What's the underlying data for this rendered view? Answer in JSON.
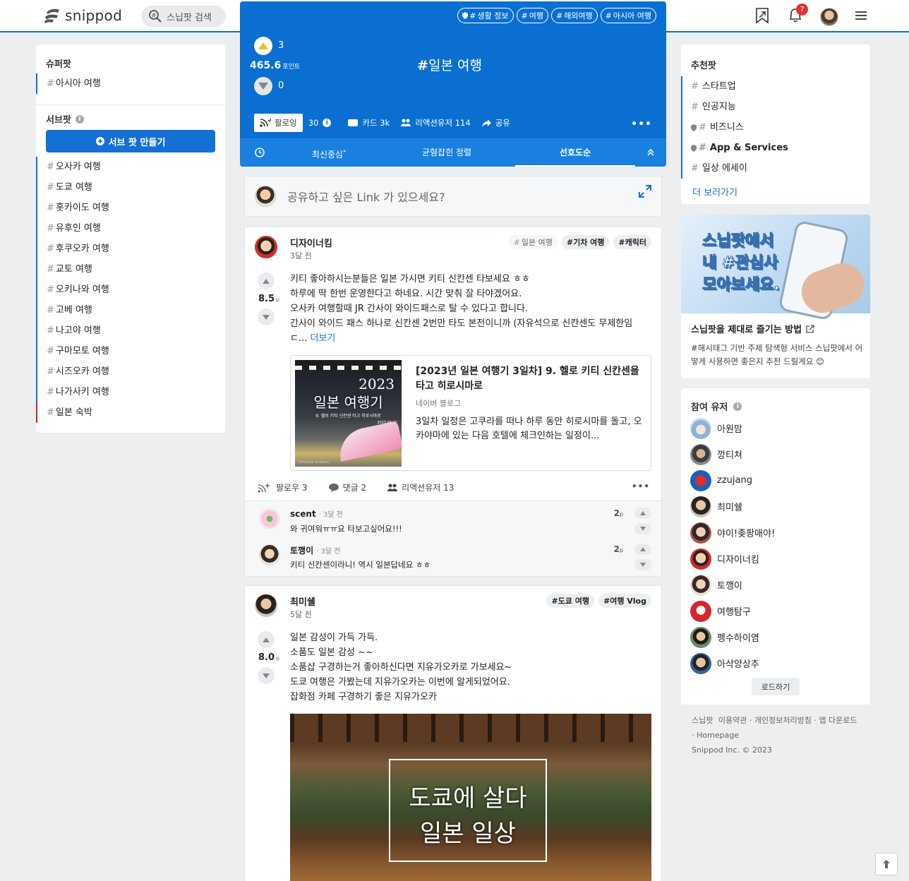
{
  "app": {
    "name": "snippod",
    "search_placeholder": "스닙팟 검색",
    "notifications_count": "7"
  },
  "left": {
    "super_title": "슈퍼팟",
    "super_items": [
      "아시아 여행"
    ],
    "sub_title": "서브팟",
    "make_sub_label": "서브 팟 만들기",
    "sub_items": [
      "오사카 여행",
      "도쿄 여행",
      "홋카이도 여행",
      "유후인 여행",
      "후쿠오카 여행",
      "교토 여행",
      "오키나와 여행",
      "고베 여행",
      "나고야 여행",
      "구마모토 여행",
      "시즈오카 여행",
      "나가사키 여행",
      "일본 숙박"
    ]
  },
  "hero": {
    "tags": [
      "생활 정보",
      "여행",
      "해외여행",
      "아시아 여행"
    ],
    "up_count": "3",
    "points": "465.6",
    "points_unit": "포인트",
    "down_count": "0",
    "title": "일본 여행",
    "follow_label": "팔로잉",
    "follow_count": "30",
    "cards_label": "카드 3k",
    "reactions_label": "리액션유저 114",
    "share_label": "공유",
    "tabs": [
      "최신중심",
      "균형잡힌 정렬",
      "선호도순"
    ],
    "tab_star": "*"
  },
  "compose": {
    "placeholder": "공유하고 싶은 Link 가 있으세요?"
  },
  "posts": [
    {
      "author": "디자이너킴",
      "time": "3달 전",
      "tags": [
        "일본 여행",
        "기차 여행",
        "캐릭터"
      ],
      "score": "8.5",
      "score_unit": "p",
      "body": [
        "키티 좋아하시는분들은 일본 가시면 키티 신칸센 타보세요 ㅎㅎ",
        "하루에 딱 한번 운영한다고 하네요. 시간 맞춰 잘 타야겠어요.",
        "오사카 여행할때 JR 간사이 와이드패스로 탈 수 있다고 합니다.",
        "간사이 와이드 패스 하나로 신칸센 2번만 타도 본전이니까 (자유석으로 신칸센도 무제한임",
        "ㄷ..."
      ],
      "more_label": "더보기",
      "link": {
        "title": "[2023년 일본 여행기 3일차] 9. 헬로 키티 신칸센을 타고 히로시마로",
        "source": "네이버 블로그",
        "desc": "3일차 일정은 고쿠라를 떠나 하루 동안 히로시마를 돌고, 오카야마에 있는 다음 호텔에 체크인하는 일정이...",
        "thumb_year": "2023",
        "thumb_title": "일본 여행기",
        "thumb_sub": "9. 헬로 키티 신칸센 타고 히로시마로",
        "thumb_date": "2023.05.20",
        "thumb_sign": "Christine Graham"
      },
      "follow_label": "팔로우 3",
      "comments_label": "댓글 2",
      "reactions_label": "리액션유저 13",
      "comments": [
        {
          "name": "scent",
          "time": "· 3달 전",
          "text": "와 귀여워ㅠㅠ요 타보고싶어요!!!",
          "points": "2",
          "unit": "p"
        },
        {
          "name": "토깽이",
          "time": "· 3달 전",
          "text": "키티 신칸센이라니! 역시 일본답네요 ㅎㅎ",
          "points": "2",
          "unit": "p"
        }
      ]
    },
    {
      "author": "최미쉘",
      "time": "5달 전",
      "tags": [
        "도쿄 여행",
        "여행 Vlog"
      ],
      "score": "8.0",
      "score_unit": "p",
      "body": [
        "일본 감성이 가득 가득.",
        "소품도 일본 감성 ~~",
        "소품샵 구경하는거 좋아하신다면 지유가오카로 가보세요~",
        "도쿄 여행은 가봤는데 지유가오카는 이번에 알게되었어요.",
        "잡화점 카페 구경하기 좋은 지유가오카"
      ],
      "image_line1": "도쿄에 살다",
      "image_line2": "일본 일상"
    }
  ],
  "recommend": {
    "title": "추천팟",
    "items": [
      "스타트업",
      "인공지능",
      "비즈니스",
      "App & Services",
      "일상 에세이"
    ],
    "more_label": "더 보러가기"
  },
  "banner": {
    "line1": "스닙팟에서",
    "line2": "내 #관심사",
    "line3": "모아보세요.",
    "title": "스닙팟을 제대로 즐기는 방법",
    "desc": "#해시태그 기반 주제 탐색형 서비스 스닙팟에서 어떻게 사용하면 좋은지 추천 드릴게요 😊"
  },
  "users": {
    "title": "참여 유저",
    "list": [
      "아원맘",
      "깡티쳐",
      "zzujang",
      "최미쉘",
      "야이!좆팡매야!",
      "디자이너킴",
      "토깽이",
      "여행탐구",
      "펭수하이염",
      "아삭양상추"
    ],
    "load_label": "로드하기"
  },
  "footer": {
    "links": [
      "스닙팟",
      "이용약관",
      "개인정보처리방침",
      "앱 다운로드",
      "Homepage"
    ],
    "copyright": "Snippod Inc. © 2023"
  }
}
